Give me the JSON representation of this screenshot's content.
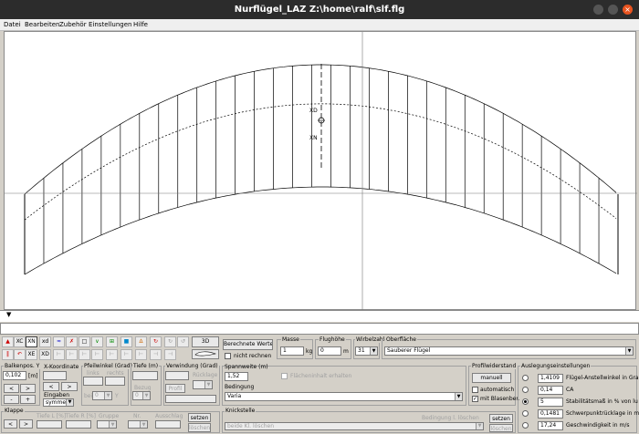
{
  "window": {
    "title": "Nurflügel_LAZ  Z:\\home\\ralf\\slf.flg"
  },
  "menu": [
    "Datei",
    "Bearbeiten",
    "Zubehör",
    "Einstellungen",
    "Hilfe"
  ],
  "canvas": {
    "xd_label": "XD",
    "xn_label": "XN"
  },
  "toolbar": {
    "row1": [
      "",
      "XC",
      "XN",
      "xd",
      "",
      "",
      "",
      "",
      "",
      "",
      "",
      "",
      ""
    ],
    "row2": [
      "",
      "",
      "XE",
      "XD",
      "",
      "",
      "",
      "",
      "",
      "",
      "",
      "",
      ""
    ],
    "btn_3d": "3D"
  },
  "berechnete": {
    "button": "Berechnete Werte",
    "nicht_rechnen": "nicht rechnen"
  },
  "masse": {
    "label": "Masse",
    "value": "1",
    "unit": "kg"
  },
  "flughoehe": {
    "label": "Flughöhe",
    "value": "0",
    "unit": "m"
  },
  "wirbelzahl": {
    "label": "Wirbelzahl",
    "value": "31"
  },
  "oberflaeche": {
    "label": "Oberfläche",
    "value": "Sauberer Flügel"
  },
  "balkenpos": {
    "label": "Balkenpos. Y",
    "value": "0,102",
    "unit": "[m]",
    "eingaben": "Eingaben",
    "symmetrie": "symmetri"
  },
  "xkoord": {
    "label": "X-Koordinate"
  },
  "pfeil": {
    "label": "Pfeilwinkel (Grad)",
    "links": "links",
    "rechts": "rechts",
    "bei": "bei",
    "bei_val": "0",
    "y": "Y"
  },
  "tiefe": {
    "label": "Tiefe (m)",
    "bezug": "Bezug",
    "bezug_val": "0"
  },
  "verwindung": {
    "label": "Verwindung (Grad)",
    "rucklage": "Rücklage",
    "profil": "Profil"
  },
  "spannweite": {
    "label": "Spannweite (m)",
    "value": "1,52",
    "flaechen": "Flächeninhalt erhalten",
    "bedingung_label": "Bedingung",
    "bedingung_value": "Varia"
  },
  "profilwiderstand": {
    "label": "Profilwiderstand",
    "manuell": "manuell",
    "automatisch": "automatisch",
    "blasen": "mit Blasenber."
  },
  "auslegung": {
    "label": "Auslegungseinstellungen",
    "rows": [
      {
        "value": "1,4109",
        "label": "Flügel-Anstellwinkel in Grad",
        "selected": false
      },
      {
        "value": "0,14",
        "label": "CA",
        "selected": false
      },
      {
        "value": "5",
        "label": "Stabilitätsmaß in % von lu",
        "selected": true
      },
      {
        "value": "0,1481",
        "label": "Schwerpunktrücklage in m",
        "selected": false
      },
      {
        "value": "17,24",
        "label": "Geschwindigkeit in m/s",
        "selected": false
      }
    ]
  },
  "klappe": {
    "label": "Klappe",
    "tiefe_l": "Tiefe L [%]",
    "tiefe_r": "Tiefe R [%]",
    "gruppe": "Gruppe",
    "nr": "Nr.",
    "ausschlag": "Ausschlag",
    "setzen": "setzen",
    "loeschen": "löschen"
  },
  "knickstelle": {
    "label": "Knickstelle",
    "bedingung_l": "Bedingung l. löschen",
    "beide": "beide Kl. löschen",
    "setzen": "setzen",
    "loeschen": "löschen"
  }
}
